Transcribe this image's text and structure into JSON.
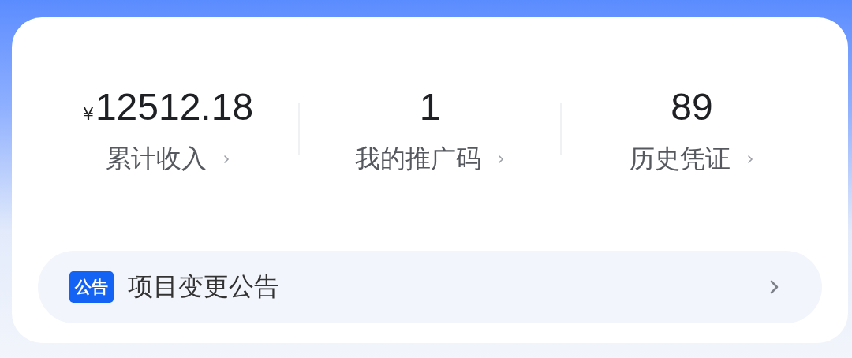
{
  "stats": [
    {
      "currency": "¥",
      "value": "12512.18",
      "label": "累计收入"
    },
    {
      "value": "1",
      "label": "我的推广码"
    },
    {
      "value": "89",
      "label": "历史凭证"
    }
  ],
  "notice": {
    "tag": "公告",
    "text": "项目变更公告"
  }
}
